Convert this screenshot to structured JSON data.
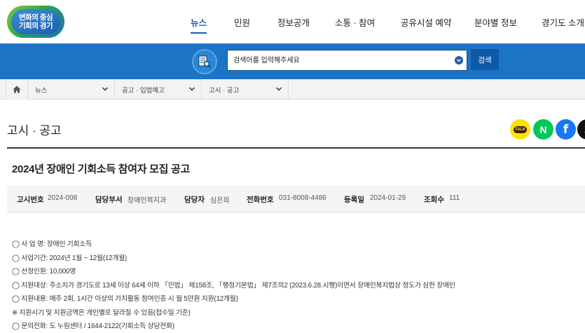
{
  "header": {
    "logo_line1": "변화의 중심",
    "logo_line2": "기회의 경기",
    "nav": [
      "뉴스",
      "민원",
      "정보공개",
      "소통 · 참여",
      "공유시설 예약",
      "분야별 정보",
      "경기도 소개"
    ],
    "active_nav": "뉴스",
    "colors": {
      "brand_blue": "#1d73c4",
      "accent": "#1a5fae"
    }
  },
  "search": {
    "placeholder": "검색어를 입력해주세요",
    "button_label": "검색",
    "icon": "document-search-icon"
  },
  "breadcrumb": {
    "home_icon": "home-icon",
    "items": [
      "뉴스",
      "공고 · 입법예고",
      "고시 · 공고"
    ]
  },
  "page": {
    "title": "고시 · 공고",
    "sns": {
      "kakao_label": "TALK",
      "naver_label": "N",
      "facebook_label": "f",
      "x_label": "X"
    }
  },
  "post": {
    "title": "2024년 장애인 기회소득 참여자 모집 공고",
    "meta": [
      {
        "label": "고시번호",
        "value": "2024-008"
      },
      {
        "label": "담당부서",
        "value": "장애인복지과"
      },
      {
        "label": "담당자",
        "value": "심은희"
      },
      {
        "label": "전화번호",
        "value": "031-8008-4486"
      },
      {
        "label": "등록일",
        "value": "2024-01-29"
      },
      {
        "label": "조회수",
        "value": "111"
      }
    ],
    "body": [
      "◯ 사 업 명: 장애인 기회소득",
      "◯ 사업기간: 2024년 1월 ~ 12월(12개월)",
      "◯ 선정인원: 10,000명",
      "◯ 지원대상: 주소지가 경기도로 13세 이상 64세 이하 「민법」 제158조, 「행정기본법」 제7조의2 (2023.6.28.시행)이면서 장애인복지법상 정도가 심한 장애인",
      "◯ 지원내용: 매주 2회, 1시간 이상의 가치활동 참여인증 시 월 5만원 지원(12개월)",
      "※ 지원시기 및 지원금액은 개인별로 달라질 수 있음(접수일 기준)",
      "◯ 문의전화: 도 누림센터 / 1644-2122(기회소득 상담전화)"
    ]
  }
}
